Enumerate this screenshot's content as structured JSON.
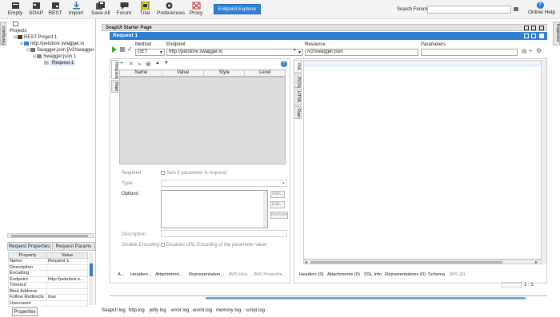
{
  "toolbar": {
    "buttons": [
      {
        "label": "Empty",
        "icon": "empty-project-icon",
        "color": "#3a3a3a"
      },
      {
        "label": "SOAP",
        "icon": "soap-icon",
        "color": "#3a3a3a"
      },
      {
        "label": "REST",
        "icon": "rest-icon",
        "color": "#3a3a3a"
      },
      {
        "label": "Import",
        "icon": "import-icon",
        "color": "#2f6fbd"
      },
      {
        "label": "Save All",
        "icon": "save-all-icon",
        "color": "#3a3a3a"
      },
      {
        "label": "Forum",
        "icon": "forum-icon",
        "color": "#3a3a3a"
      },
      {
        "label": "Trial",
        "icon": "trial-icon",
        "color": "#e8d400"
      },
      {
        "label": "Preferences",
        "icon": "gear-icon",
        "color": "#3a3a3a"
      },
      {
        "label": "Proxy",
        "icon": "proxy-icon",
        "color": "#cc2b2b"
      }
    ],
    "endpoint_explorer": "Endpoint Explorer",
    "search_label": "Search Forum",
    "search_value": "",
    "online_help": "Online Help"
  },
  "side_tabs": {
    "navigator": "Navigator",
    "inspector": "Inspector"
  },
  "navigator": {
    "projects_label": "Projects",
    "tree": {
      "project": "REST Project 1",
      "service": "http://petstore.swagger.io",
      "resource": "Swagger.json [/v2/swagger",
      "method": "Swagger.json 1",
      "request": "Request 1"
    }
  },
  "properties": {
    "tabs": [
      "Request Properties",
      "Request Params"
    ],
    "columns": [
      "Property",
      "Value"
    ],
    "rows": [
      {
        "name": "Name",
        "value": "Request 1"
      },
      {
        "name": "Description",
        "value": ""
      },
      {
        "name": "Encoding",
        "value": ""
      },
      {
        "name": "Endpoint",
        "value": "http://petstore.s..."
      },
      {
        "name": "Timeout",
        "value": ""
      },
      {
        "name": "Bind Address",
        "value": ""
      },
      {
        "name": "Follow Redirects",
        "value": "true"
      },
      {
        "name": "Username",
        "value": ""
      }
    ],
    "button": "Properties"
  },
  "main": {
    "starter_tab": "SoapUI Starter Page",
    "request_title": "Request 1",
    "labels": {
      "method": "Method",
      "endpoint": "Endpoint",
      "resource": "Resource",
      "parameters": "Parameters"
    },
    "method_value": "GET",
    "endpoint_value": "http://petstore.swagger.io",
    "resource_value": "/v2/swagger.json",
    "parameters_value": ""
  },
  "request_editor": {
    "side_tabs": [
      "Request",
      "Raw"
    ],
    "param_columns": [
      "Name",
      "Value",
      "Style",
      "Level"
    ],
    "form": {
      "required": "Required:",
      "required_hint": "Sets if parameter is required",
      "type": "Type:",
      "options": "Options:",
      "description": "Description:",
      "disable_encoding": "Disable Encoding:",
      "disable_hint": "Disables URL-Encoding of the parameter value",
      "buttons": [
        "Add...",
        "Edit...",
        "Remove"
      ]
    },
    "bottom_tabs": [
      "A...",
      "Headers...",
      "Attachment...",
      "Representation...",
      "JMS Hea...",
      "JMS Propertie..."
    ]
  },
  "response_editor": {
    "side_tabs": [
      "XML",
      "JSON",
      "HTML",
      "Raw"
    ],
    "bottom_tabs": [
      "Headers (0)",
      "Attachments (0)",
      "SSL Info",
      "Representations (0)",
      "Schema",
      "JMS (0)"
    ],
    "cursor": "1 : 1"
  },
  "log_tabs": [
    "SoapUI log",
    "http log",
    "jetty log",
    "error log",
    "wsrm log",
    "memory log",
    "script log"
  ],
  "colors": {
    "accent": "#2f7fd4",
    "selection": "#cfe2f7"
  }
}
